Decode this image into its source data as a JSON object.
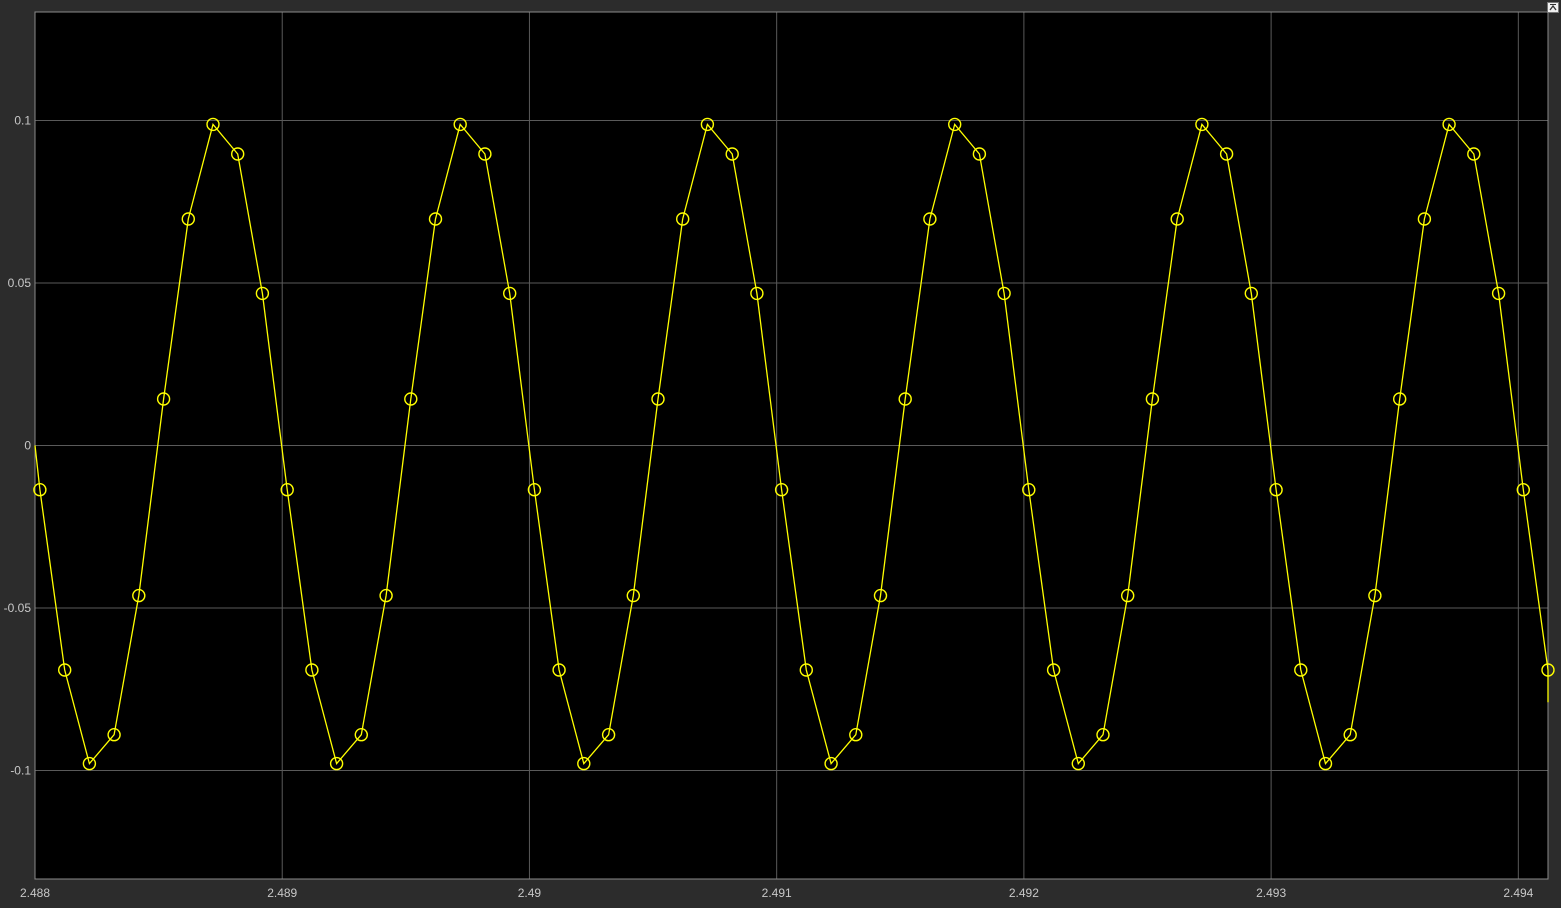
{
  "colors": {
    "figure_background": "#2c2c2c",
    "axes_background": "#000000",
    "grid": "#5a5a5a",
    "tick_text": "#c8c8c8",
    "series": "#ffff00"
  },
  "icons": {
    "toolbar": "restore-icon"
  },
  "chart_data": {
    "type": "line",
    "title": "",
    "xlabel": "",
    "ylabel": "",
    "xlim": [
      2.488,
      2.49412
    ],
    "ylim": [
      -0.1334,
      0.1334
    ],
    "grid": true,
    "legend": "none",
    "marker": "circle",
    "x_ticks": [
      {
        "value": 2.488,
        "label": "2.488"
      },
      {
        "value": 2.489,
        "label": "2.489"
      },
      {
        "value": 2.49,
        "label": "2.49"
      },
      {
        "value": 2.491,
        "label": "2.491"
      },
      {
        "value": 2.492,
        "label": "2.492"
      },
      {
        "value": 2.493,
        "label": "2.493"
      },
      {
        "value": 2.494,
        "label": "2.494"
      }
    ],
    "y_ticks": [
      {
        "value": 0.1,
        "label": "0.1"
      },
      {
        "value": 0.05,
        "label": "0.05"
      },
      {
        "value": 0,
        "label": "0"
      },
      {
        "value": -0.05,
        "label": "-0.05"
      },
      {
        "value": -0.1,
        "label": "-0.1"
      }
    ],
    "series": [
      {
        "sample_period": 0.0001,
        "first_sample_x": 2.48802,
        "period_values": [
          -0.0136,
          -0.0691,
          -0.0979,
          -0.089,
          -0.0462,
          0.0143,
          0.0697,
          0.0988,
          0.0897,
          0.0468
        ],
        "line_start": {
          "x": 2.488,
          "y": 0.0
        },
        "line_end": {
          "x": 2.49412,
          "y": -0.079
        }
      }
    ]
  }
}
